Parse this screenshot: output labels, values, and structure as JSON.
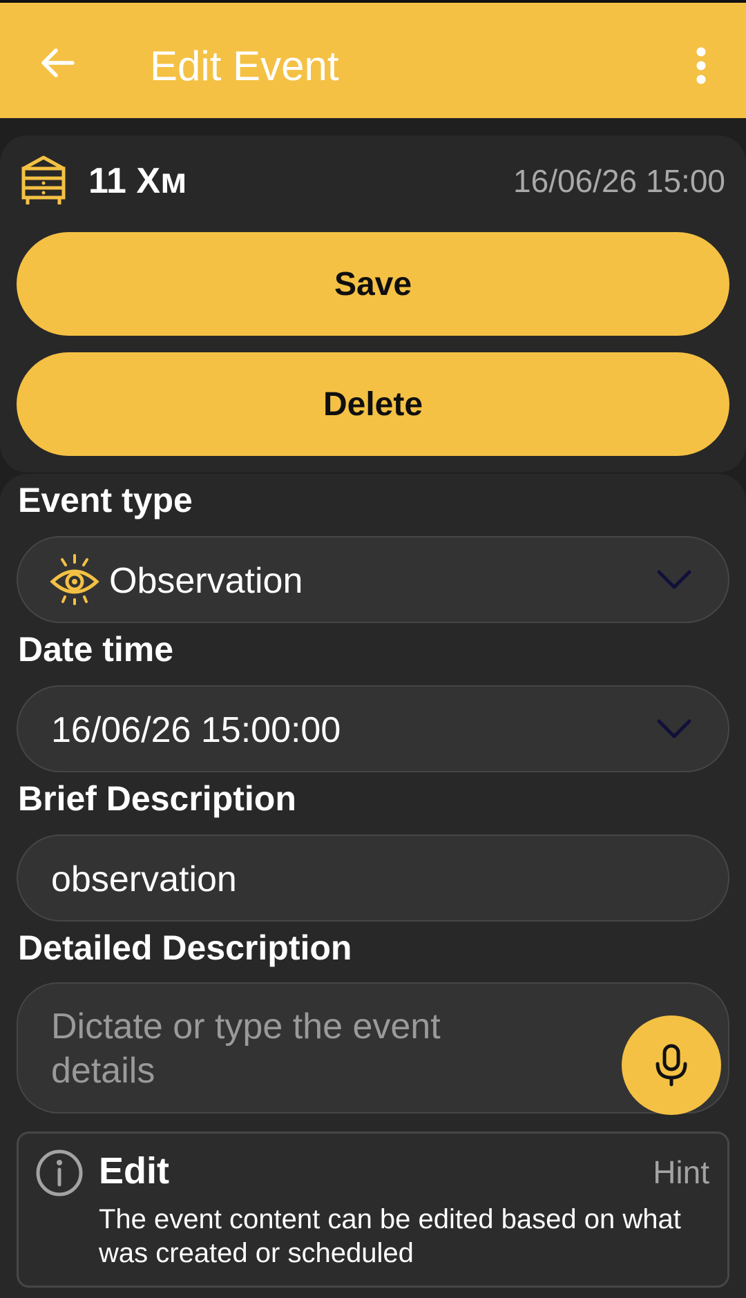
{
  "header": {
    "title": "Edit Event",
    "back_icon": "arrow-left-icon",
    "menu_icon": "more-vert-icon"
  },
  "hive": {
    "icon": "beehive-icon",
    "name": "11 Хм",
    "datetime": "16/06/26 15:00"
  },
  "actions": {
    "save_label": "Save",
    "delete_label": "Delete"
  },
  "form": {
    "event_type": {
      "label": "Event type",
      "value": "Observation",
      "icon": "eye-icon"
    },
    "date_time": {
      "label": "Date time",
      "value": "16/06/26 15:00:00"
    },
    "brief": {
      "label": "Brief Description",
      "value": "observation"
    },
    "detailed": {
      "label": "Detailed Description",
      "placeholder": "Dictate or type the event details",
      "mic_icon": "microphone-icon"
    }
  },
  "hint": {
    "title": "Edit",
    "tag": "Hint",
    "text": "The event content can be edited based on what was created or scheduled",
    "icon": "info-icon"
  },
  "colors": {
    "accent": "#f4c144",
    "background": "#1f1f1f",
    "card": "#282828",
    "field": "#333333"
  }
}
